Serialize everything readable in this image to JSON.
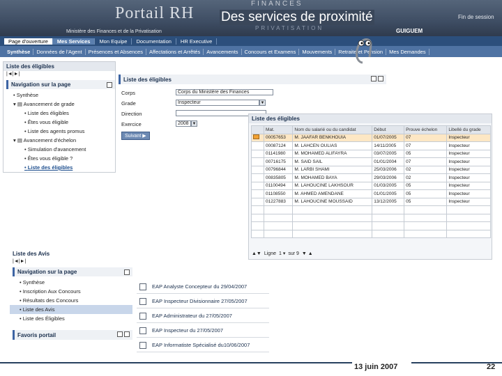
{
  "header": {
    "brand": "Portail RH",
    "finances": "FINANCES",
    "privatisation": "PRIVATISATION",
    "ministere": "Ministère des Finances et de la Privatisation",
    "title": "Des services de proximité",
    "fin_session": "Fin de session",
    "user": "GUIGUEM"
  },
  "nav1": [
    "Page d'ouverture",
    "Mes Services",
    "Mon Equipe",
    "Documentation",
    "HR Executive"
  ],
  "nav2": [
    "Synthèse",
    "Données de l'Agent",
    "Présences et Absences",
    "Affectations et Arrêtés",
    "Avancements",
    "Concours et Examens",
    "Mouvements",
    "Retraite et Pension",
    "Mes Demandes"
  ],
  "left_panel": {
    "title": "Liste des éligibles",
    "icons": "|◄|►|",
    "nav_head": "Navigation sur la page",
    "items": [
      "Synthèse",
      "Avancement de grade",
      "Liste des éligibles",
      "Êtes vous éligible",
      "Liste des agents promus",
      "Avancement d'échelon",
      "Simulation d'avancement",
      "Êtes vous éligible ?",
      "Liste des éligibles"
    ]
  },
  "form": {
    "title": "Liste des éligibles",
    "corps_label": "Corps",
    "corps_value": "Corps du Ministère des Finances",
    "grade_label": "Grade",
    "grade_value": "Inspecteur",
    "direction_label": "Direction",
    "exercice_label": "Exercice",
    "exercice_value": "2008",
    "submit": "Suivant"
  },
  "table": {
    "title": "Liste des éligibles",
    "headers": [
      "Mat.",
      "Nom du salarié ou du candidat",
      "Début",
      "Prouve échelon",
      "Libellé du grade"
    ],
    "rows": [
      [
        "00057653",
        "M. JAAFAR BENKHOUIA",
        "01/07/2005",
        "07",
        "Inspecteur"
      ],
      [
        "00087124",
        "M. LAHCEN OULIAS",
        "14/11/2005",
        "07",
        "Inspecteur"
      ],
      [
        "01141980",
        "M. MOHAMED ALIFAYRA",
        "03/07/2005",
        "05",
        "Inspecteur"
      ],
      [
        "00716175",
        "M. SAID SAIL",
        "01/01/2004",
        "07",
        "Inspecteur"
      ],
      [
        "00796844",
        "M. LARBI SHAMI",
        "25/03/2006",
        "02",
        "Inspecteur"
      ],
      [
        "00835805",
        "M. MOHAMED BAYA",
        "29/03/2006",
        "02",
        "Inspecteur"
      ],
      [
        "01100494",
        "M. LAHOUCINE LAKHSOUR",
        "01/03/2005",
        "05",
        "Inspecteur"
      ],
      [
        "01108550",
        "M. AHMED AMENDANE",
        "01/01/2005",
        "05",
        "Inspecteur"
      ],
      [
        "01227883",
        "M. LAHOUCINE MOUSSAID",
        "13/12/2005",
        "05",
        "Inspecteur"
      ]
    ],
    "empty_rows": 4,
    "footer_ligne": "Ligne",
    "footer_sur": "sur 9"
  },
  "avis": {
    "title": "Liste des Avis",
    "nav_head": "Navigation sur la page",
    "items": [
      "Synthèse",
      "Inscription Aux Concours",
      "Résultats des Concours",
      "Liste des Avis",
      "Liste des Éligibles"
    ],
    "favoris": "Favoris portail",
    "list": [
      "EAP Analyste Concepteur du 29/04/2007",
      "EAP Inspecteur Divisionnaire 27/05/2007",
      "EAP Administrateur du 27/05/2007",
      "EAP Inspecteur du 27/05/2007",
      "EAP Informatiste Spécialisé du10/06/2007"
    ]
  },
  "footer": {
    "date": "13 juin 2007",
    "page": "22"
  }
}
